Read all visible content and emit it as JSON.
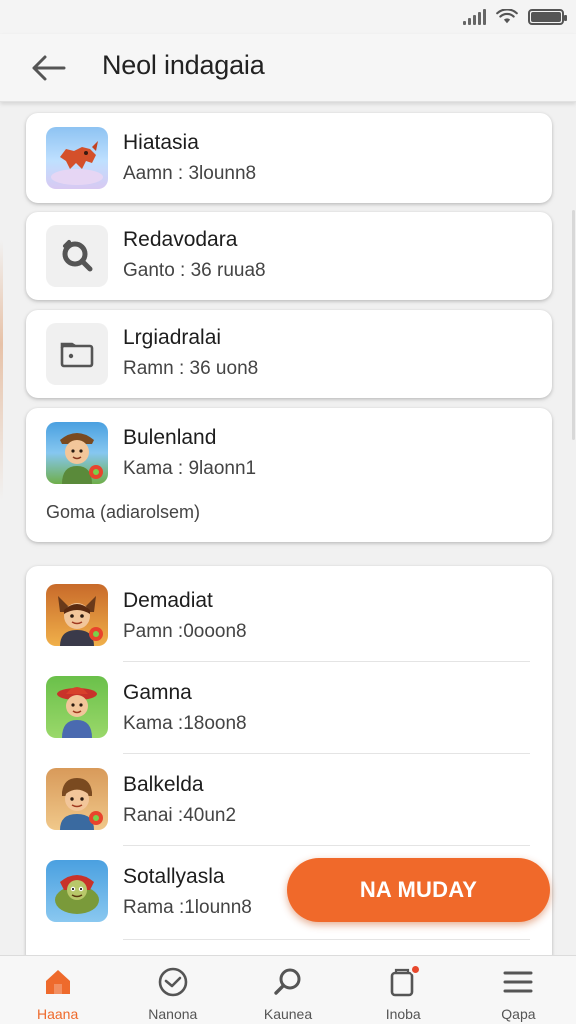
{
  "header": {
    "title": "Neol indagaia"
  },
  "cards": [
    {
      "title": "Hiatasia",
      "subtitle": "Aamn : 3lounn8",
      "icon": "fox-game-icon"
    },
    {
      "title": "Redavodara",
      "subtitle": "Ganto : 36 ruua8",
      "icon": "search-tool-icon"
    },
    {
      "title": "Lrgiadralai",
      "subtitle": "Ramn : 36 uon8",
      "icon": "folder-icon"
    },
    {
      "title": "Bulenland",
      "subtitle": "Kama : 9laonn1",
      "note": "Goma (adiarolsem)",
      "icon": "explorer-game-icon"
    }
  ],
  "list": [
    {
      "title": "Demadiat",
      "subtitle": "Pamn :0ooon8",
      "icon": "warrior-game-icon"
    },
    {
      "title": "Gamna",
      "subtitle": "Kama :18oon8",
      "icon": "farmer-game-icon"
    },
    {
      "title": "Balkelda",
      "subtitle": "Ranai :40un2",
      "icon": "boy-game-icon"
    },
    {
      "title": "Sotallyasla",
      "subtitle": "Rama :1lounn8",
      "icon": "turtle-game-icon"
    }
  ],
  "fab": {
    "label": "NA MUDAY"
  },
  "nav": [
    {
      "label": "Haana",
      "icon": "home-icon",
      "active": true
    },
    {
      "label": "Nanona",
      "icon": "clock-icon",
      "active": false
    },
    {
      "label": "Kaunea",
      "icon": "search-icon",
      "active": false
    },
    {
      "label": "Inoba",
      "icon": "inbox-icon",
      "active": false
    },
    {
      "label": "Qapa",
      "icon": "menu-icon",
      "active": false
    }
  ],
  "colors": {
    "accent": "#f0692a",
    "background": "#f1f1f1",
    "card": "#ffffff"
  }
}
